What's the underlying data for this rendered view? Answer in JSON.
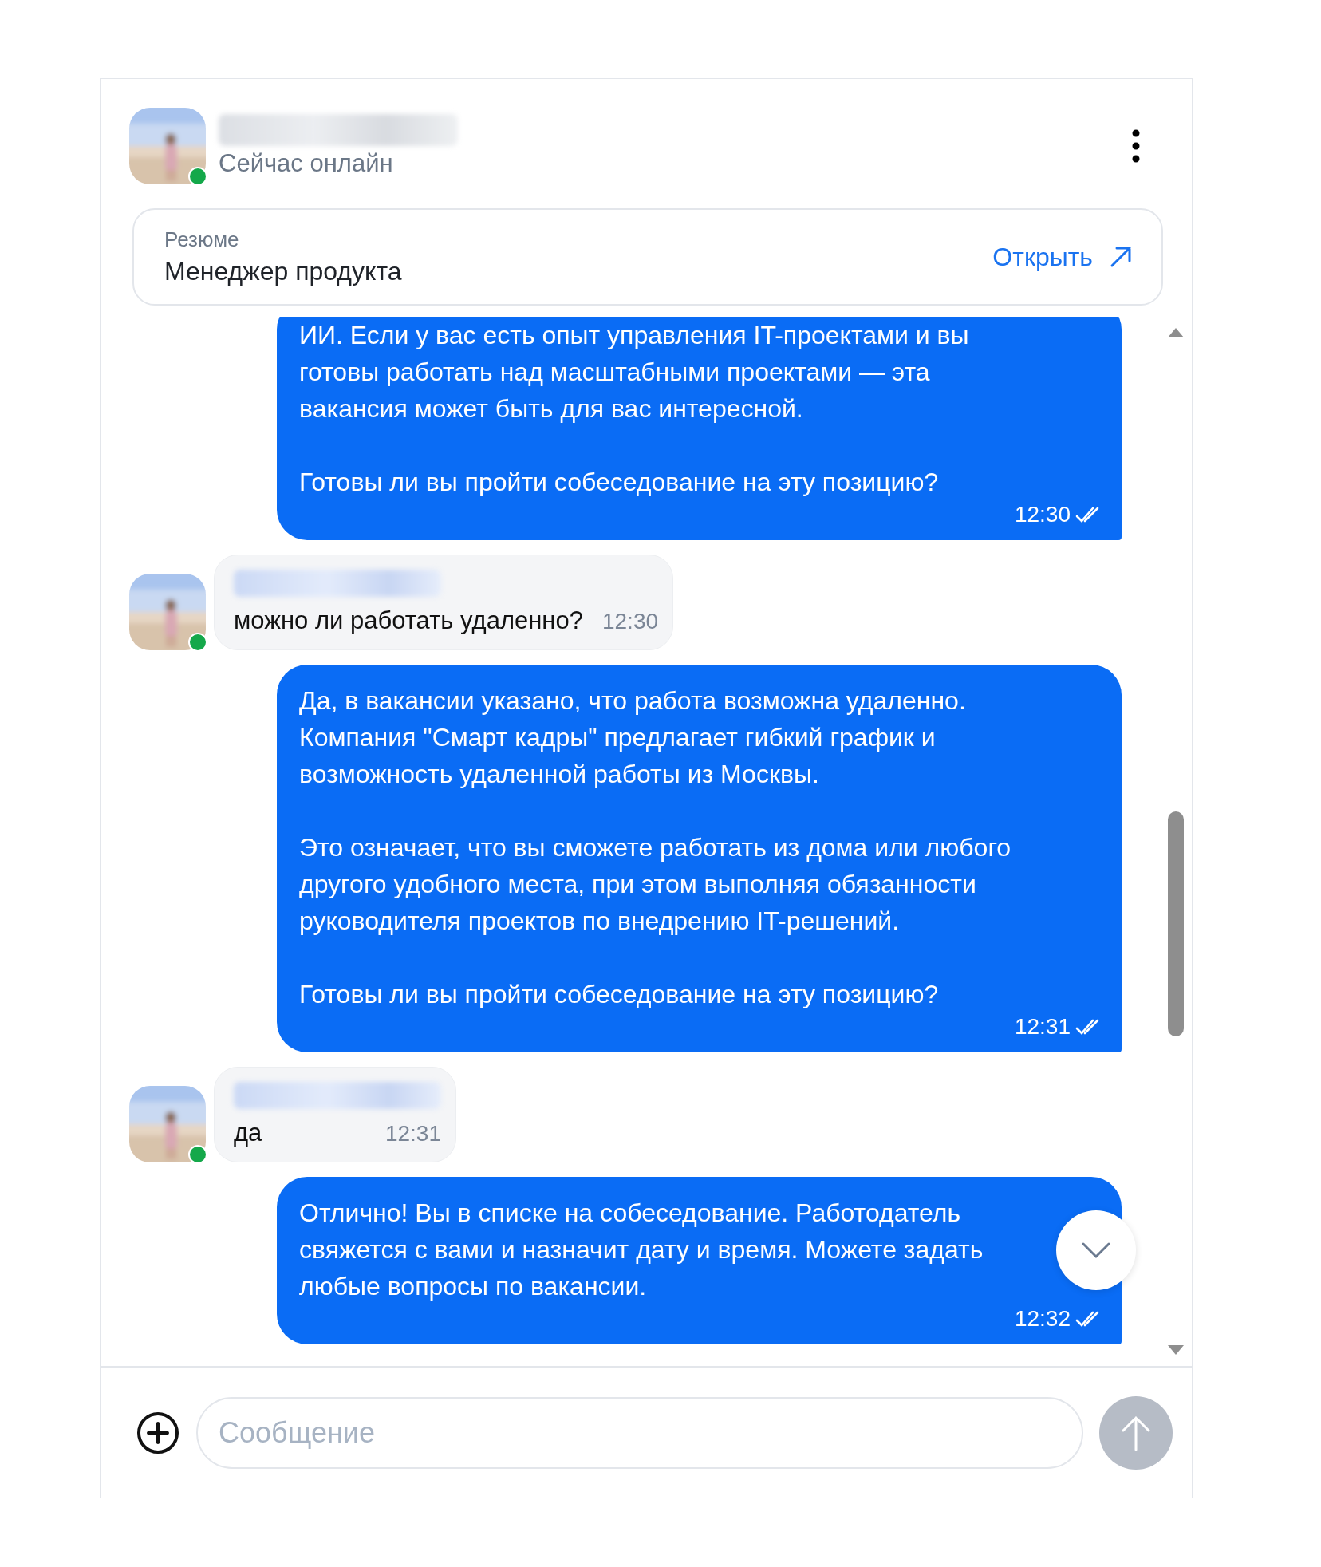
{
  "header": {
    "status": "Сейчас онлайн",
    "online": true
  },
  "resume": {
    "label": "Резюме",
    "title": "Менеджер продукта",
    "open_link": "Открыть"
  },
  "messages": [
    {
      "kind": "outgoing",
      "paragraphs": [
        "ИИ. Если у вас есть опыт управления IT-проектами и вы готовы работать над масштабными проектами — эта вакансия может быть для вас интересной.",
        "Готовы ли вы пройти собеседование на эту позицию?"
      ],
      "time": "12:30",
      "read": true
    },
    {
      "kind": "incoming",
      "paragraphs": [
        "можно ли работать удаленно?"
      ],
      "time": "12:30",
      "online": true
    },
    {
      "kind": "outgoing",
      "paragraphs": [
        "Да, в вакансии указано, что работа возможна удаленно. Компания \"Смарт кадры\" предлагает гибкий график и возможность удаленной работы из Москвы.",
        "Это означает, что вы сможете работать из дома или любого другого удобного места, при этом выполняя обязанности руководителя проектов по внедрению IT-решений.",
        "Готовы ли вы пройти собеседование на эту позицию?"
      ],
      "time": "12:31",
      "read": true
    },
    {
      "kind": "incoming",
      "paragraphs": [
        "да"
      ],
      "time": "12:31",
      "online": true
    },
    {
      "kind": "outgoing",
      "paragraphs": [
        "Отлично! Вы в списке на собеседование. Работодатель свяжется с вами и назначит дату и время. Можете задать любые вопросы по вакансии."
      ],
      "time": "12:32",
      "read": true
    }
  ],
  "composer": {
    "placeholder": "Сообщение"
  }
}
